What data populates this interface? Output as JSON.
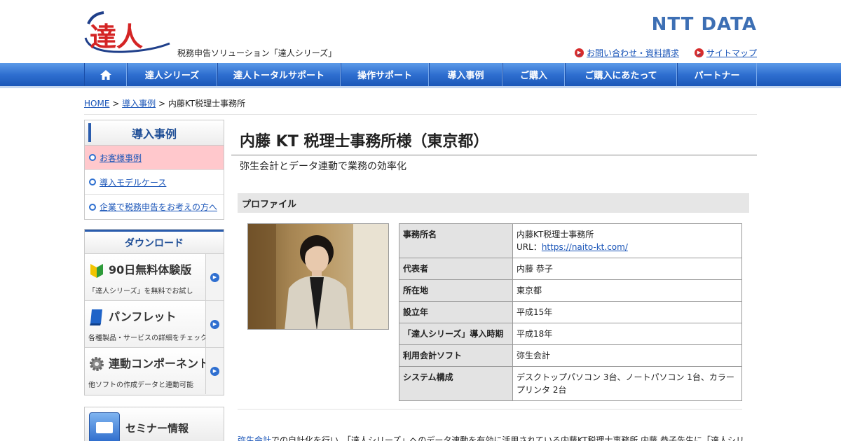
{
  "header": {
    "logo_text": "達人",
    "tagline": "税務申告ソリューション「達人シリーズ」",
    "brand": "NTT DATA",
    "links": [
      {
        "label": "お問い合わせ・資料請求"
      },
      {
        "label": "サイトマップ"
      }
    ]
  },
  "nav": {
    "items": [
      {
        "label": "",
        "icon": "home-icon"
      },
      {
        "label": "達人シリーズ"
      },
      {
        "label": "達人トータルサポート"
      },
      {
        "label": "操作サポート"
      },
      {
        "label": "導入事例"
      },
      {
        "label": "ご購入"
      },
      {
        "label": "ご購入にあたって"
      },
      {
        "label": "パートナー"
      }
    ]
  },
  "breadcrumb": {
    "home": "HOME",
    "sep": ">",
    "section": "導入事例",
    "current": "内藤KT税理士事務所"
  },
  "sidebar": {
    "title": "導入事例",
    "items": [
      {
        "label": "お客様事例",
        "active": true
      },
      {
        "label": "導入モデルケース",
        "active": false
      },
      {
        "label": "企業で税務申告をお考えの方へ",
        "active": false
      }
    ]
  },
  "download": {
    "title": "ダウンロード",
    "items": [
      {
        "title": "90日無料体験版",
        "sub": "「達人シリーズ」を無料でお試し",
        "icon": "beginner-leaf-icon"
      },
      {
        "title": "パンフレット",
        "sub": "各種製品・サービスの詳細をチェック",
        "icon": "brochure-icon"
      },
      {
        "title": "連動コンポーネント",
        "sub": "他ソフトの作成データと連動可能",
        "icon": "gear-icon"
      }
    ]
  },
  "seminar": {
    "title": "セミナー情報",
    "icon": "seminar-icon"
  },
  "main": {
    "title": "内藤 KT 税理士事務所様（東京都）",
    "subtitle": "弥生会計とデータ連動で業務の効率化",
    "section_title": "プロファイル",
    "photo_alt": "内藤 恭子 先生"
  },
  "profile": [
    {
      "key": "事務所名",
      "value": "内藤KT税理士事務所",
      "url_label": "URL：",
      "url": "https://naito-kt.com/"
    },
    {
      "key": "代表者",
      "value": "内藤 恭子"
    },
    {
      "key": "所在地",
      "value": "東京都"
    },
    {
      "key": "設立年",
      "value": "平成15年"
    },
    {
      "key": "「達人シリーズ」導入時期",
      "value": "平成18年"
    },
    {
      "key": "利用会計ソフト",
      "value": "弥生会計"
    },
    {
      "key": "システム構成",
      "value": "デスクトップパソコン 3台、ノートパソコン 1台、カラープリンタ 2台"
    }
  ],
  "body": {
    "link": "弥生会計",
    "text": "での自計化を行い、「達人シリーズ」へのデータ連動を有効に活用されている内藤KT税理士事務所 内藤 恭子先生に「達人シリ"
  },
  "colors": {
    "nav": "#2f6fd0",
    "brand": "#3d6fb4",
    "active": "#ffc8cc",
    "red": "#d62b2b"
  }
}
